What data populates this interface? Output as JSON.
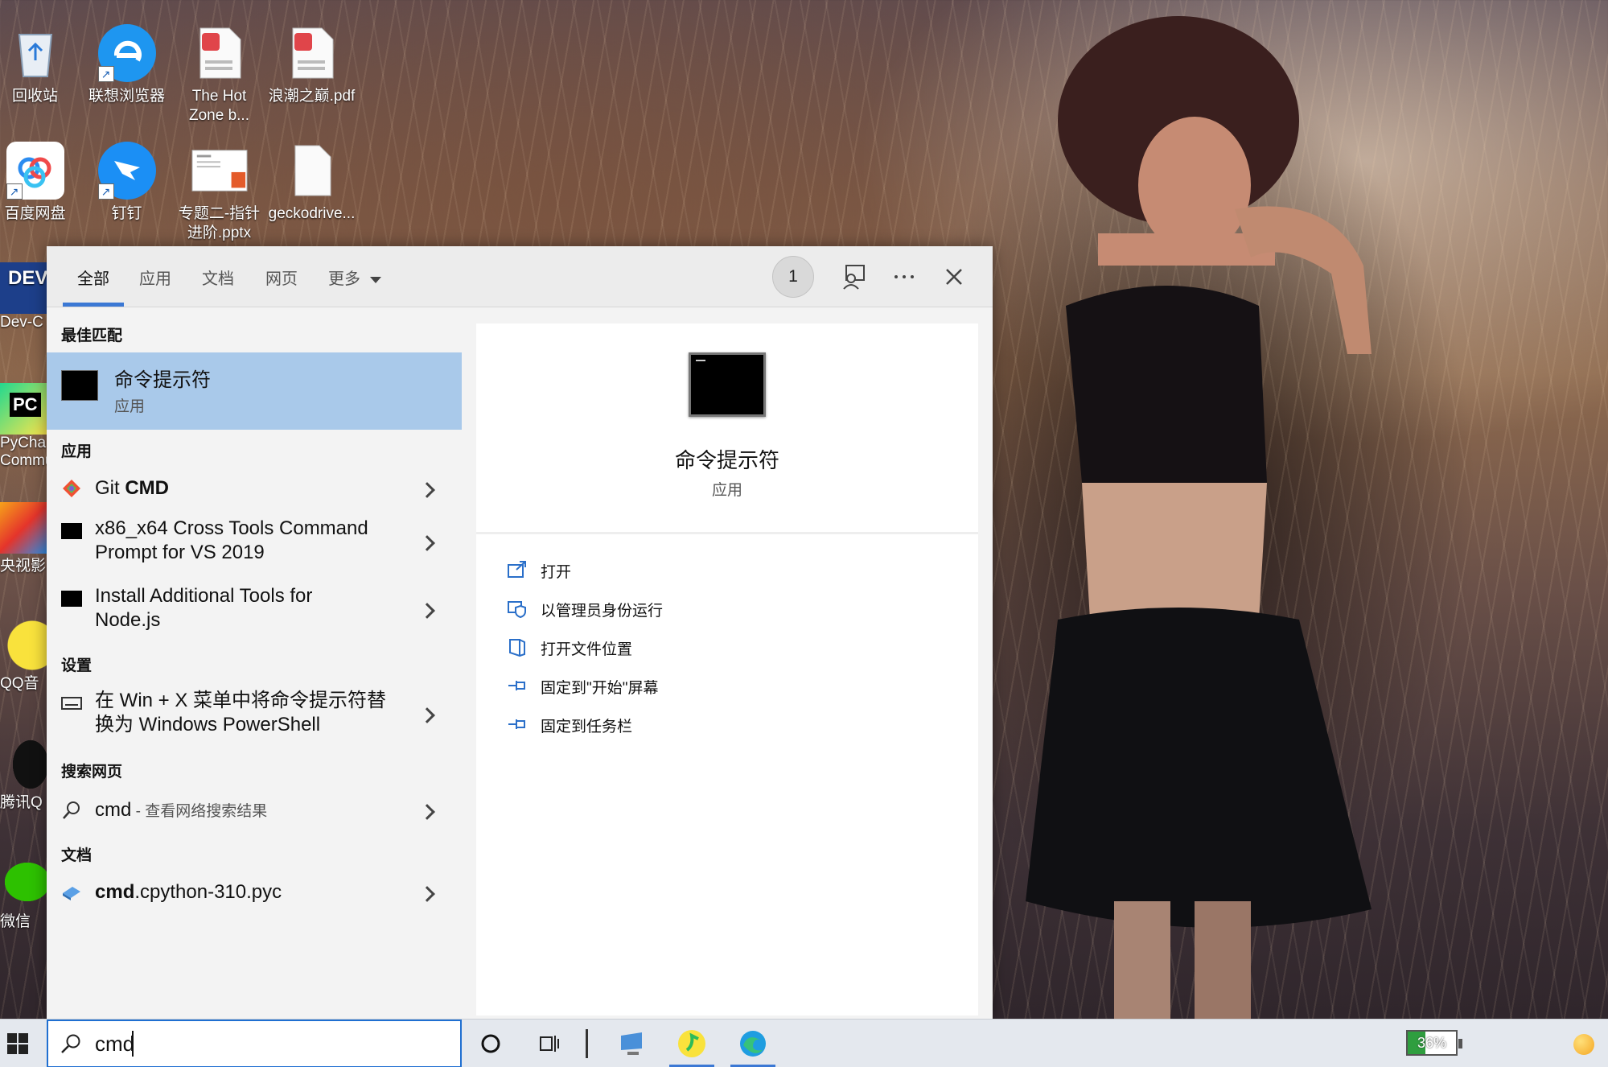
{
  "desktop": {
    "icons": [
      {
        "label": "回收站",
        "icon": "recycle-bin-icon"
      },
      {
        "label": "联想浏览器",
        "icon": "lenovo-browser-icon"
      },
      {
        "label": "The Hot Zone b...",
        "icon": "pdf-file-icon"
      },
      {
        "label": "浪潮之巅.pdf",
        "icon": "pdf-file-icon"
      },
      {
        "label": "百度网盘",
        "icon": "baidu-netdisk-icon"
      },
      {
        "label": "钉钉",
        "icon": "dingtalk-icon"
      },
      {
        "label": "专题二-指针进阶.pptx",
        "icon": "pptx-file-icon"
      },
      {
        "label": "geckodrive...",
        "icon": "file-icon"
      }
    ],
    "partial_icons": [
      {
        "label": "Dev-C",
        "icon": "dev-cpp-icon"
      },
      {
        "label": "PyCha Commu",
        "icon": "pycharm-icon"
      },
      {
        "label": "央视影",
        "icon": "cctv-video-icon"
      },
      {
        "label": "QQ音",
        "icon": "qq-music-icon"
      },
      {
        "label": "腾讯Q",
        "icon": "qq-icon"
      },
      {
        "label": "微信",
        "icon": "wechat-icon"
      }
    ]
  },
  "search_panel": {
    "tabs": [
      "全部",
      "应用",
      "文档",
      "网页",
      "更多"
    ],
    "active_tab": "全部",
    "badge_count": "1",
    "best_match_heading": "最佳匹配",
    "best_match": {
      "title": "命令提示符",
      "subtitle": "应用"
    },
    "apps_heading": "应用",
    "apps": [
      {
        "label_plain": "Git ",
        "label_bold": "CMD"
      },
      {
        "label": "x86_x64 Cross Tools Command Prompt for VS 2019",
        "line1": "x86_x64 Cross Tools Command",
        "line2": "Prompt for VS 2019"
      },
      {
        "label": "Install Additional Tools for Node.js",
        "line1": "Install Additional Tools for",
        "line2": "Node.js"
      }
    ],
    "settings_heading": "设置",
    "settings": [
      {
        "line1": "在 Win + X 菜单中将命令提示符替",
        "line2": "换为 Windows PowerShell"
      }
    ],
    "web_heading": "搜索网页",
    "web": {
      "query": "cmd",
      "suffix": " - 查看网络搜索结果"
    },
    "docs_heading": "文档",
    "docs": [
      {
        "bold": "cmd",
        "rest": ".cpython-310.pyc"
      }
    ],
    "preview": {
      "title": "命令提示符",
      "subtitle": "应用",
      "actions": [
        "打开",
        "以管理员身份运行",
        "打开文件位置",
        "固定到\"开始\"屏幕",
        "固定到任务栏"
      ]
    }
  },
  "taskbar": {
    "search_value": "cmd",
    "battery": "36%"
  },
  "colors": {
    "accent": "#3b78d4",
    "best_match_bg": "#a9c9ea",
    "panel_bg": "#f3f3f3"
  }
}
